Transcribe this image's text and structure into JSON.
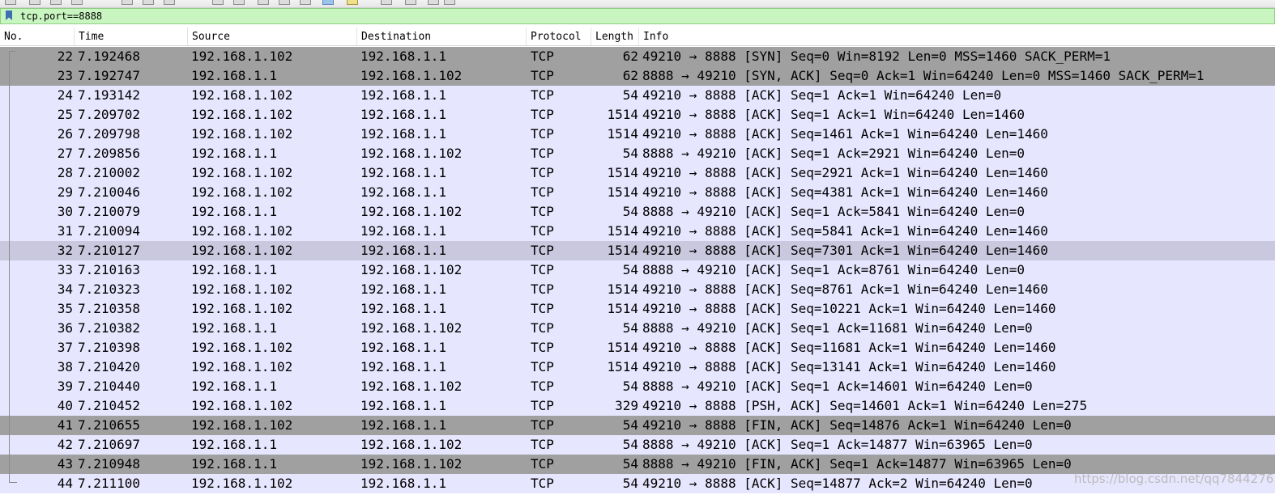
{
  "filter": {
    "value": "tcp.port==8888"
  },
  "columns": {
    "no": "No.",
    "time": "Time",
    "source": "Source",
    "destination": "Destination",
    "protocol": "Protocol",
    "length": "Length",
    "info": "Info"
  },
  "colors": {
    "row_ack": "#e7e6ff",
    "row_syn_fin": "#a0a0a0",
    "row_selected": "#c9c8de",
    "filter_bg": "#c9f6c0"
  },
  "packets": [
    {
      "no": "22",
      "time": "7.192468",
      "source": "192.168.1.102",
      "destination": "192.168.1.1",
      "protocol": "TCP",
      "length": "62",
      "info": "49210 → 8888 [SYN] Seq=0 Win=8192 Len=0 MSS=1460 SACK_PERM=1",
      "style": "syn"
    },
    {
      "no": "23",
      "time": "7.192747",
      "source": "192.168.1.1",
      "destination": "192.168.1.102",
      "protocol": "TCP",
      "length": "62",
      "info": "8888 → 49210 [SYN, ACK] Seq=0 Ack=1 Win=64240 Len=0 MSS=1460 SACK_PERM=1",
      "style": "syn"
    },
    {
      "no": "24",
      "time": "7.193142",
      "source": "192.168.1.102",
      "destination": "192.168.1.1",
      "protocol": "TCP",
      "length": "54",
      "info": "49210 → 8888 [ACK] Seq=1 Ack=1 Win=64240 Len=0",
      "style": "ack"
    },
    {
      "no": "25",
      "time": "7.209702",
      "source": "192.168.1.102",
      "destination": "192.168.1.1",
      "protocol": "TCP",
      "length": "1514",
      "info": "49210 → 8888 [ACK] Seq=1 Ack=1 Win=64240 Len=1460",
      "style": "ack"
    },
    {
      "no": "26",
      "time": "7.209798",
      "source": "192.168.1.102",
      "destination": "192.168.1.1",
      "protocol": "TCP",
      "length": "1514",
      "info": "49210 → 8888 [ACK] Seq=1461 Ack=1 Win=64240 Len=1460",
      "style": "ack"
    },
    {
      "no": "27",
      "time": "7.209856",
      "source": "192.168.1.1",
      "destination": "192.168.1.102",
      "protocol": "TCP",
      "length": "54",
      "info": "8888 → 49210 [ACK] Seq=1 Ack=2921 Win=64240 Len=0",
      "style": "ack"
    },
    {
      "no": "28",
      "time": "7.210002",
      "source": "192.168.1.102",
      "destination": "192.168.1.1",
      "protocol": "TCP",
      "length": "1514",
      "info": "49210 → 8888 [ACK] Seq=2921 Ack=1 Win=64240 Len=1460",
      "style": "ack"
    },
    {
      "no": "29",
      "time": "7.210046",
      "source": "192.168.1.102",
      "destination": "192.168.1.1",
      "protocol": "TCP",
      "length": "1514",
      "info": "49210 → 8888 [ACK] Seq=4381 Ack=1 Win=64240 Len=1460",
      "style": "ack"
    },
    {
      "no": "30",
      "time": "7.210079",
      "source": "192.168.1.1",
      "destination": "192.168.1.102",
      "protocol": "TCP",
      "length": "54",
      "info": "8888 → 49210 [ACK] Seq=1 Ack=5841 Win=64240 Len=0",
      "style": "ack"
    },
    {
      "no": "31",
      "time": "7.210094",
      "source": "192.168.1.102",
      "destination": "192.168.1.1",
      "protocol": "TCP",
      "length": "1514",
      "info": "49210 → 8888 [ACK] Seq=5841 Ack=1 Win=64240 Len=1460",
      "style": "ack"
    },
    {
      "no": "32",
      "time": "7.210127",
      "source": "192.168.1.102",
      "destination": "192.168.1.1",
      "protocol": "TCP",
      "length": "1514",
      "info": "49210 → 8888 [ACK] Seq=7301 Ack=1 Win=64240 Len=1460",
      "style": "sel"
    },
    {
      "no": "33",
      "time": "7.210163",
      "source": "192.168.1.1",
      "destination": "192.168.1.102",
      "protocol": "TCP",
      "length": "54",
      "info": "8888 → 49210 [ACK] Seq=1 Ack=8761 Win=64240 Len=0",
      "style": "ack"
    },
    {
      "no": "34",
      "time": "7.210323",
      "source": "192.168.1.102",
      "destination": "192.168.1.1",
      "protocol": "TCP",
      "length": "1514",
      "info": "49210 → 8888 [ACK] Seq=8761 Ack=1 Win=64240 Len=1460",
      "style": "ack"
    },
    {
      "no": "35",
      "time": "7.210358",
      "source": "192.168.1.102",
      "destination": "192.168.1.1",
      "protocol": "TCP",
      "length": "1514",
      "info": "49210 → 8888 [ACK] Seq=10221 Ack=1 Win=64240 Len=1460",
      "style": "ack"
    },
    {
      "no": "36",
      "time": "7.210382",
      "source": "192.168.1.1",
      "destination": "192.168.1.102",
      "protocol": "TCP",
      "length": "54",
      "info": "8888 → 49210 [ACK] Seq=1 Ack=11681 Win=64240 Len=0",
      "style": "ack"
    },
    {
      "no": "37",
      "time": "7.210398",
      "source": "192.168.1.102",
      "destination": "192.168.1.1",
      "protocol": "TCP",
      "length": "1514",
      "info": "49210 → 8888 [ACK] Seq=11681 Ack=1 Win=64240 Len=1460",
      "style": "ack"
    },
    {
      "no": "38",
      "time": "7.210420",
      "source": "192.168.1.102",
      "destination": "192.168.1.1",
      "protocol": "TCP",
      "length": "1514",
      "info": "49210 → 8888 [ACK] Seq=13141 Ack=1 Win=64240 Len=1460",
      "style": "ack"
    },
    {
      "no": "39",
      "time": "7.210440",
      "source": "192.168.1.1",
      "destination": "192.168.1.102",
      "protocol": "TCP",
      "length": "54",
      "info": "8888 → 49210 [ACK] Seq=1 Ack=14601 Win=64240 Len=0",
      "style": "ack"
    },
    {
      "no": "40",
      "time": "7.210452",
      "source": "192.168.1.102",
      "destination": "192.168.1.1",
      "protocol": "TCP",
      "length": "329",
      "info": "49210 → 8888 [PSH, ACK] Seq=14601 Ack=1 Win=64240 Len=275",
      "style": "ack"
    },
    {
      "no": "41",
      "time": "7.210655",
      "source": "192.168.1.102",
      "destination": "192.168.1.1",
      "protocol": "TCP",
      "length": "54",
      "info": "49210 → 8888 [FIN, ACK] Seq=14876 Ack=1 Win=64240 Len=0",
      "style": "syn"
    },
    {
      "no": "42",
      "time": "7.210697",
      "source": "192.168.1.1",
      "destination": "192.168.1.102",
      "protocol": "TCP",
      "length": "54",
      "info": "8888 → 49210 [ACK] Seq=1 Ack=14877 Win=63965 Len=0",
      "style": "ack"
    },
    {
      "no": "43",
      "time": "7.210948",
      "source": "192.168.1.1",
      "destination": "192.168.1.102",
      "protocol": "TCP",
      "length": "54",
      "info": "8888 → 49210 [FIN, ACK] Seq=1 Ack=14877 Win=63965 Len=0",
      "style": "syn"
    },
    {
      "no": "44",
      "time": "7.211100",
      "source": "192.168.1.102",
      "destination": "192.168.1.1",
      "protocol": "TCP",
      "length": "54",
      "info": "49210 → 8888 [ACK] Seq=14877 Ack=2 Win=64240 Len=0",
      "style": "ack"
    }
  ],
  "watermark": "https://blog.csdn.net/qq7844276"
}
